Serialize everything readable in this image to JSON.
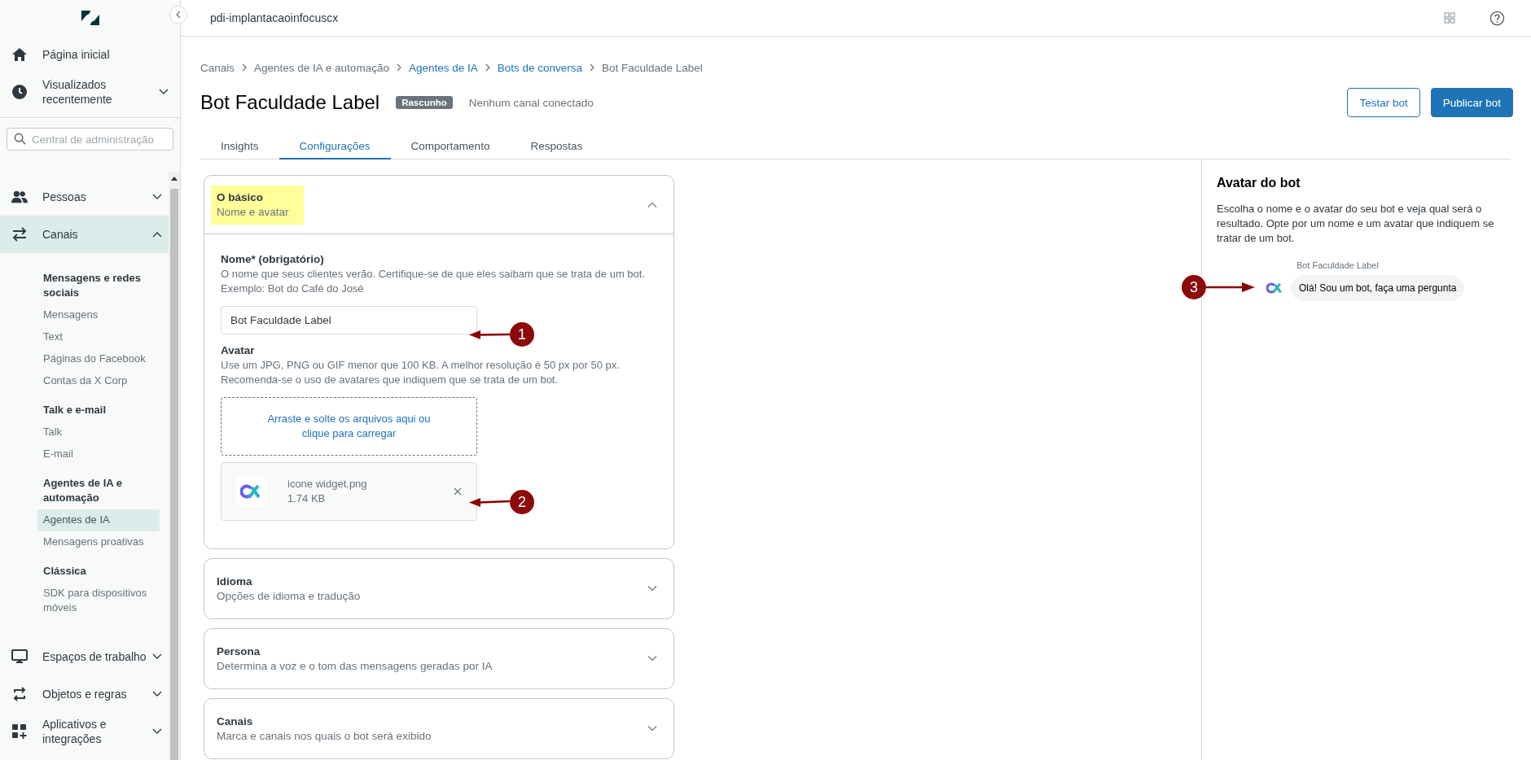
{
  "sidebar": {
    "top_items": [
      {
        "label": "Página inicial",
        "selected": false
      },
      {
        "label": "Visualizados recentemente",
        "expanded": false,
        "selected": false
      }
    ],
    "search": {
      "placeholder": "Central de administração"
    },
    "items": [
      {
        "label": "Pessoas",
        "expanded": false,
        "selected": false
      },
      {
        "label": "Canais",
        "expanded": true,
        "selected": true,
        "groups": [
          {
            "title": "Mensagens e redes sociais",
            "links": [
              {
                "label": "Mensagens",
                "selected": false
              },
              {
                "label": "Text",
                "selected": false
              },
              {
                "label": "Páginas do Facebook",
                "selected": false
              },
              {
                "label": "Contas da X Corp",
                "selected": false
              }
            ]
          },
          {
            "title": "Talk e e-mail",
            "links": [
              {
                "label": "Talk",
                "selected": false
              },
              {
                "label": "E-mail",
                "selected": false
              }
            ]
          },
          {
            "title": "Agentes de IA e automação",
            "links": [
              {
                "label": "Agentes de IA",
                "selected": true
              },
              {
                "label": "Mensagens proativas",
                "selected": false
              }
            ]
          },
          {
            "title": "Clássica",
            "links": [
              {
                "label": "SDK para dispositivos móveis",
                "selected": false
              }
            ]
          }
        ]
      },
      {
        "label": "Espaços de trabalho",
        "expanded": false,
        "selected": false
      },
      {
        "label": "Objetos e regras",
        "expanded": false,
        "selected": false
      },
      {
        "label": "Aplicativos e integrações",
        "expanded": false,
        "selected": false
      }
    ]
  },
  "header": {
    "account": "pdi-implantacaoinfocuscx"
  },
  "breadcrumb": [
    {
      "label": "Canais",
      "link": false
    },
    {
      "label": "Agentes de IA e automação",
      "link": false
    },
    {
      "label": "Agentes de IA",
      "link": true
    },
    {
      "label": "Bots de conversa",
      "link": true
    },
    {
      "label": "Bot Faculdade Label",
      "link": false
    }
  ],
  "page": {
    "title": "Bot Faculdade Label",
    "badge": "Rascunho",
    "status": "Nenhum canal conectado",
    "buttons": [
      {
        "label": "Testar bot",
        "kind": "outline"
      },
      {
        "label": "Publicar bot",
        "kind": "primary"
      }
    ]
  },
  "tabs": [
    {
      "label": "Insights",
      "selected": false
    },
    {
      "label": "Configurações",
      "selected": true
    },
    {
      "label": "Comportamento",
      "selected": false
    },
    {
      "label": "Respostas",
      "selected": false
    }
  ],
  "sections": [
    {
      "title": "O básico",
      "subtitle": "Nome e avatar",
      "expanded": true,
      "highlighted": true
    },
    {
      "title": "Idioma",
      "subtitle": "Opções de idioma e tradução",
      "expanded": false,
      "highlighted": false
    },
    {
      "title": "Persona",
      "subtitle": "Determina a voz e o tom das mensagens geradas por IA",
      "expanded": false,
      "highlighted": false
    },
    {
      "title": "Canais",
      "subtitle": "Marca e canais nos quais o bot será exibido",
      "expanded": false,
      "highlighted": false
    }
  ],
  "basics": {
    "name_label": "Nome* (obrigatório)",
    "name_help": [
      "O nome que seus clientes verão. Certifique-se de que eles saibam que se trata de um bot.",
      "Exemplo: Bot do Café do José"
    ],
    "name_value": "Bot Faculdade Label",
    "avatar_label": "Avatar",
    "avatar_help": [
      "Use um JPG, PNG ou GIF menor que 100 KB. A melhor resolução é 50 px por 50 px.",
      "Recomenda-se o uso de avatares que indiquem que se trata de um bot."
    ],
    "dropzone": [
      "Arraste e solte os arquivos aqui ou",
      "clique para carregar"
    ],
    "file": {
      "name": "icone widget.png",
      "size": "1.74 KB"
    }
  },
  "preview": {
    "title": "Avatar do bot",
    "description": "Escolha o nome e o avatar do seu bot e veja qual será o resultado. Opte por um nome e um avatar que indiquem se tratar de um bot.",
    "bot_name": "Bot Faculdade Label",
    "message": "Olá! Sou um bot, faça uma pergunta"
  },
  "annotations": [
    {
      "label": "1"
    },
    {
      "label": "2"
    },
    {
      "label": "3"
    }
  ]
}
